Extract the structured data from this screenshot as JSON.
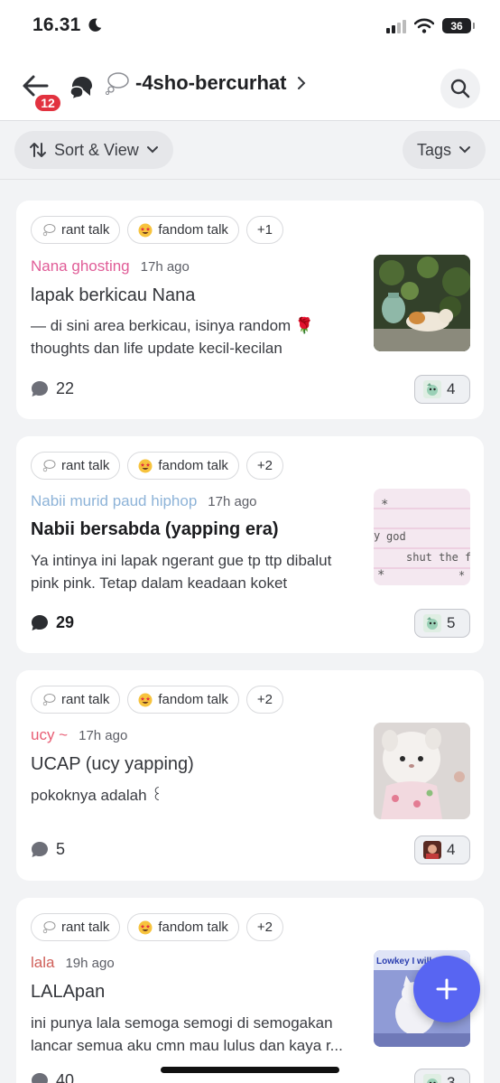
{
  "status_bar": {
    "time": "16.31",
    "battery": "36"
  },
  "header": {
    "back_badge": "12",
    "channel_name": "-4sho-bercurhat"
  },
  "filters": {
    "sort_label": "Sort & View",
    "tags_label": "Tags"
  },
  "posts": [
    {
      "tags": [
        "rant talk",
        "fandom talk",
        "+1"
      ],
      "author": "Nana ghosting",
      "author_color": "#e05c97",
      "time": "17h ago",
      "title": "lapak berkicau Nana",
      "snippet_lines": [
        "— di sini area berkicau, isinya random 🌹",
        "thoughts dan life update kecil-kecilan"
      ],
      "comments": "22",
      "reaction_count": "4"
    },
    {
      "tags": [
        "rant talk",
        "fandom talk",
        "+2"
      ],
      "author": "Nabii murid paud hiphop",
      "author_color": "#8db3d8",
      "time": "17h ago",
      "title": "Nabii bersabda (yapping era)",
      "snippet_lines": [
        "Ya intinya ini lapak ngerant gue tp ttp dibalut",
        "pink pink. Tetap dalam keadaan koket"
      ],
      "comments": "29",
      "reaction_count": "5"
    },
    {
      "tags": [
        "rant talk",
        "fandom talk",
        "+2"
      ],
      "author": "ucy ~",
      "author_color": "#e85d74",
      "time": "17h ago",
      "title": "UCAP (ucy yapping)",
      "snippet_lines": [
        "pokoknya adalah ꒰"
      ],
      "comments": "5",
      "reaction_count": "4"
    },
    {
      "tags": [
        "rant talk",
        "fandom talk",
        "+2"
      ],
      "author": "lala",
      "author_color": "#d0605a",
      "time": "19h ago",
      "title": "LALApan",
      "snippet_lines": [
        "ini punya lala semoga semogi di semogakan",
        "lancar semua aku cmn mau lulus dan kaya r..."
      ],
      "comments": "40",
      "reaction_count": "3",
      "thumb_text": "Lowkey I will"
    }
  ],
  "thumb_texts": {
    "note_line1": "god",
    "note_line2": "shut the f"
  },
  "colors": {
    "accent": "#5865f2",
    "badge": "#e2323f"
  }
}
